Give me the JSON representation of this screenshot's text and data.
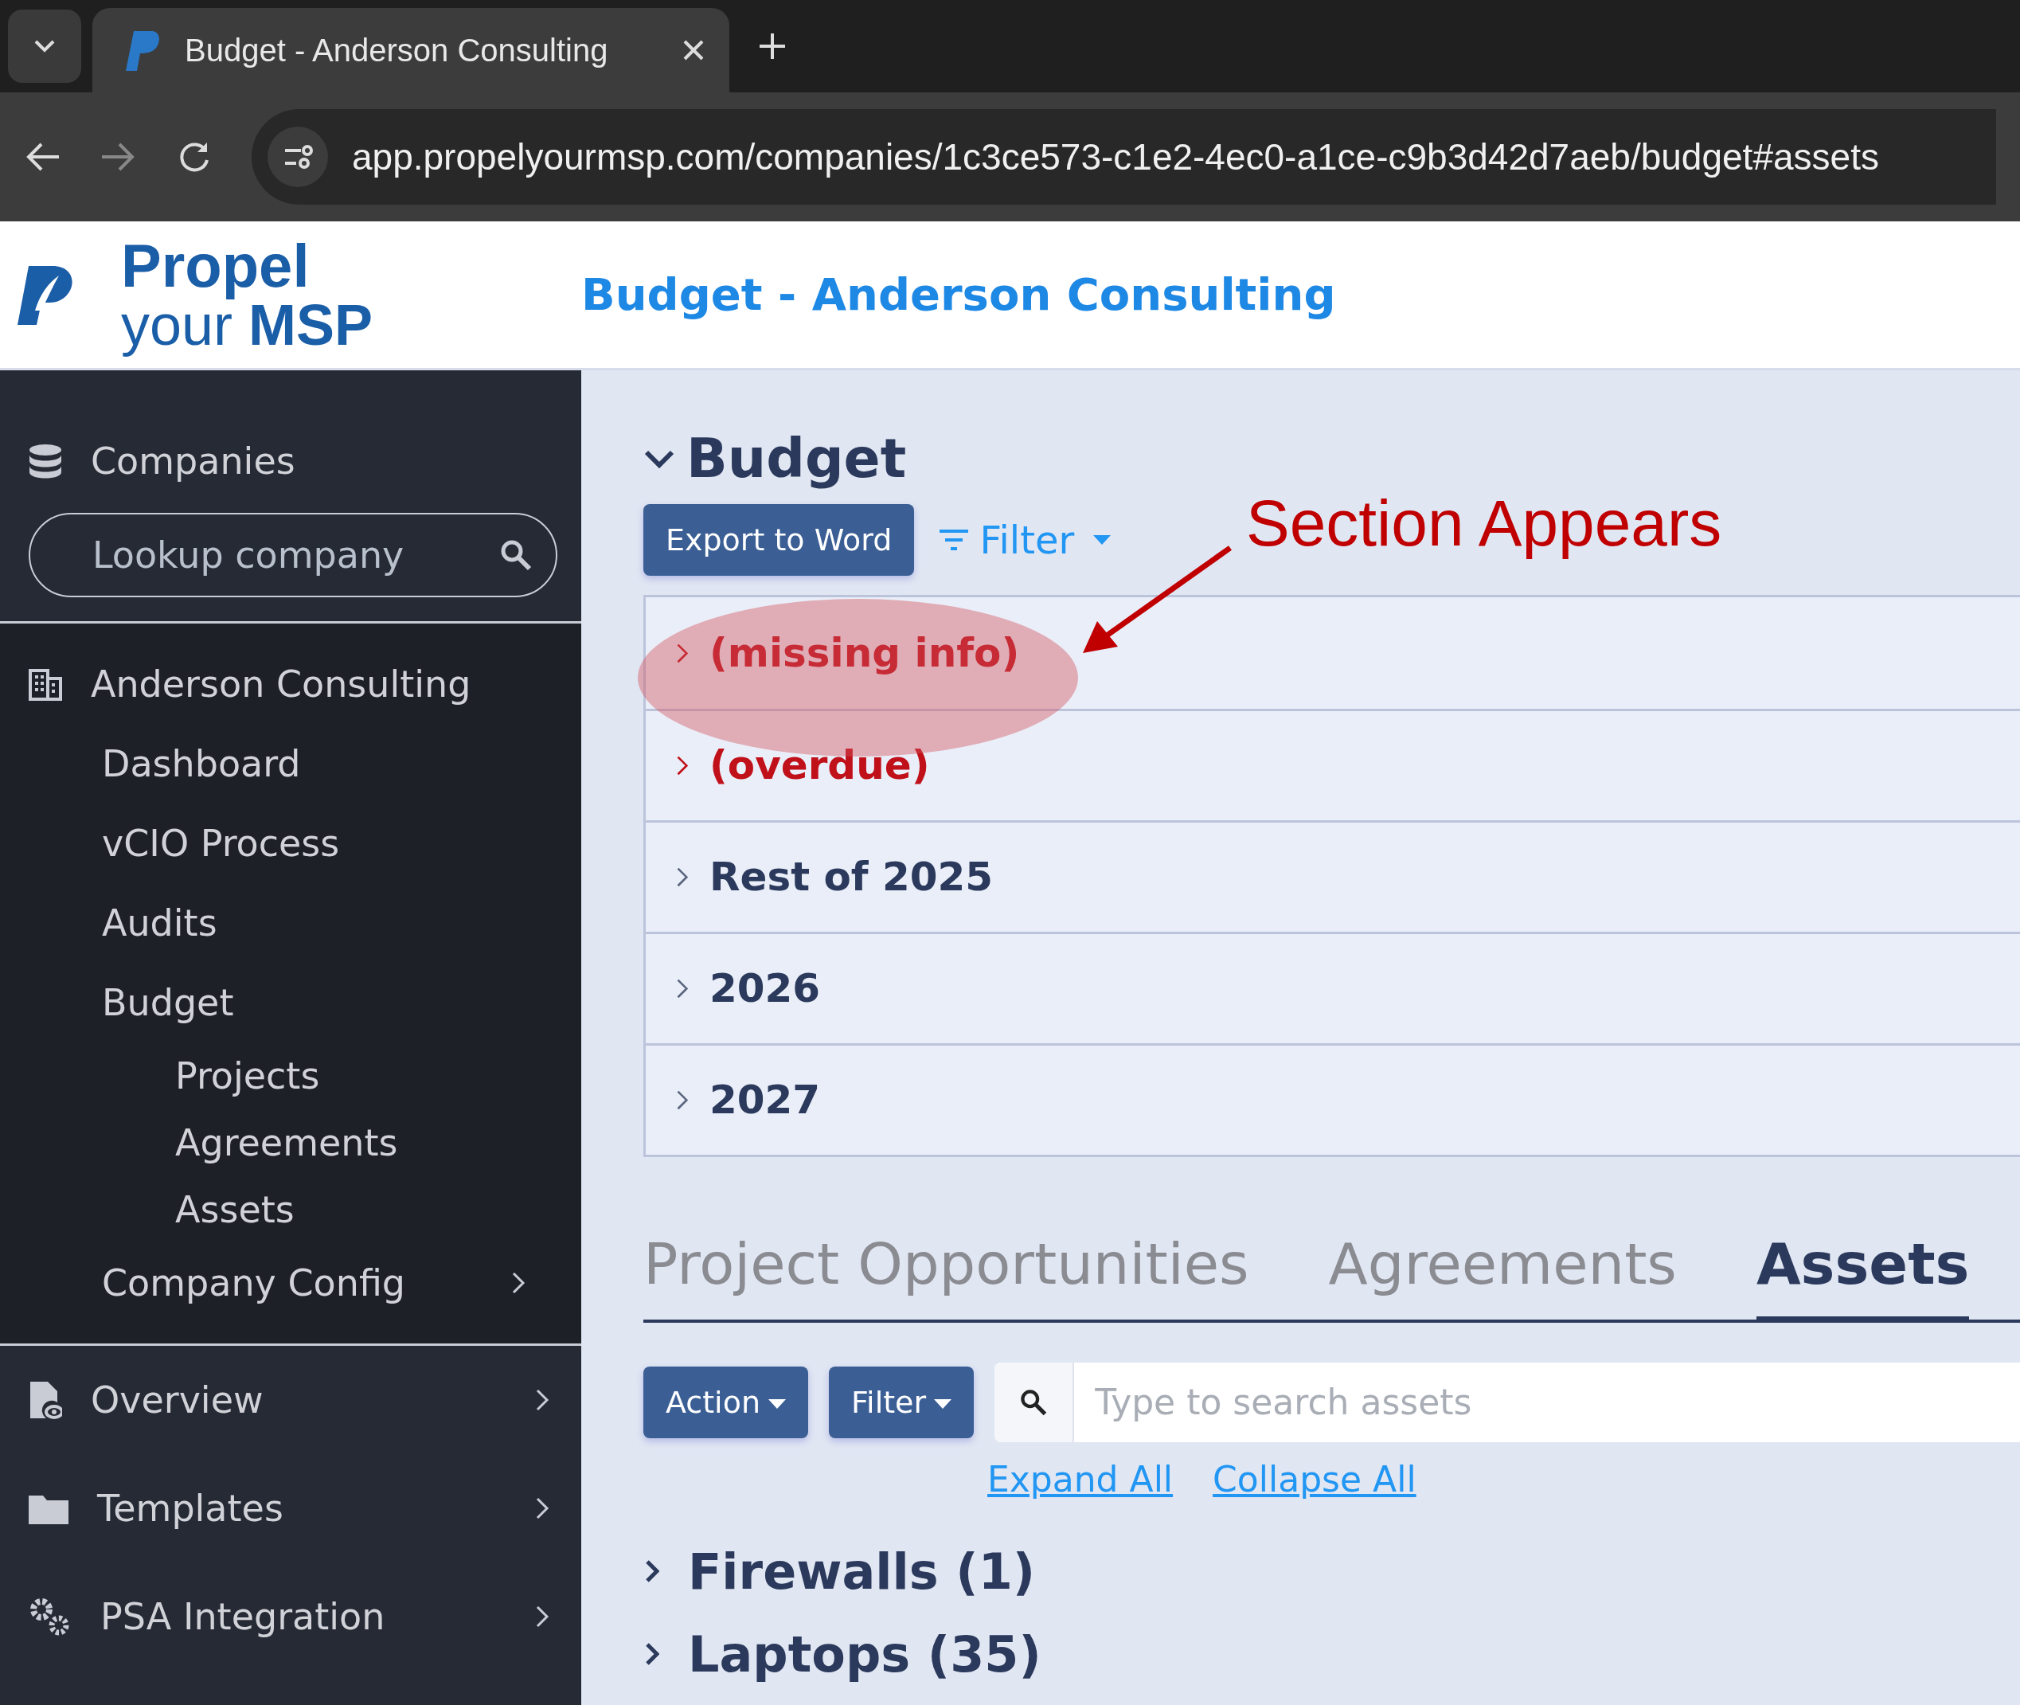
{
  "browser": {
    "tab_title": "Budget - Anderson Consulting",
    "url": "app.propelyourmsp.com/companies/1c3ce573-c1e2-4ec0-a1ce-c9b3d42d7aeb/budget#assets"
  },
  "header": {
    "logo_top": "Propel",
    "logo_bottom": "your **MSP**",
    "title": "Budget - Anderson Consulting"
  },
  "sidebar": {
    "companies_label": "Companies",
    "search": {
      "placeholder": "Lookup company"
    },
    "company": "Anderson Consulting",
    "items": [
      {
        "label": "Dashboard",
        "has_submenu": false
      },
      {
        "label": "vCIO Process",
        "has_submenu": false
      },
      {
        "label": "Audits",
        "has_submenu": false
      },
      {
        "label": "Budget",
        "has_submenu": false,
        "children": [
          {
            "label": "Projects"
          },
          {
            "label": "Agreements"
          },
          {
            "label": "Assets"
          }
        ]
      },
      {
        "label": "Company Config",
        "has_submenu": true
      }
    ],
    "sections": [
      {
        "label": "Overview",
        "kind": "report",
        "has_submenu": true
      },
      {
        "label": "Templates",
        "kind": "folder",
        "has_submenu": true
      },
      {
        "label": "PSA Integration",
        "kind": "gears",
        "has_submenu": true
      }
    ]
  },
  "budget": {
    "title": "Budget",
    "expanded": true,
    "export_button": "Export to Word",
    "filter": "Filter",
    "groups": [
      {
        "label": "(missing info)",
        "kind": "alert"
      },
      {
        "label": "(overdue)",
        "kind": "alert"
      },
      {
        "label": "Rest of 2025",
        "kind": "normal"
      },
      {
        "label": "2026",
        "kind": "normal"
      },
      {
        "label": "2027",
        "kind": "normal"
      }
    ]
  },
  "tabs": [
    {
      "label": "Project Opportunities",
      "selected": false
    },
    {
      "label": "Agreements",
      "selected": false
    },
    {
      "label": "Assets",
      "selected": true
    }
  ],
  "assets": {
    "action_button": "Action",
    "filter_button": "Filter",
    "search": {
      "placeholder": "Type to search assets"
    },
    "expand_all": "Expand All",
    "collapse_all": "Collapse All",
    "groups": [
      {
        "label": "Firewalls (1)"
      },
      {
        "label": "Laptops (35)"
      }
    ]
  },
  "annotation": {
    "text": "Section Appears"
  }
}
